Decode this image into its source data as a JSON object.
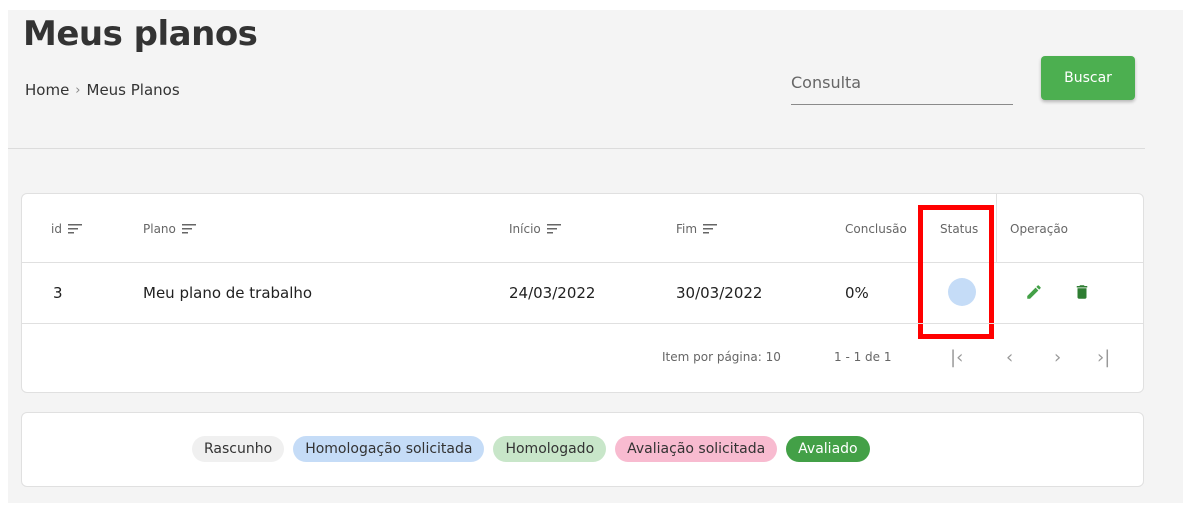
{
  "page": {
    "title": "Meus planos",
    "breadcrumb": [
      "Home",
      "Meus Planos"
    ],
    "search_placeholder": "Consulta",
    "search_button": "Buscar"
  },
  "table": {
    "columns": [
      "id",
      "Plano",
      "Início",
      "Fim",
      "Conclusão",
      "Status",
      "Operação"
    ],
    "rows": [
      {
        "id": "3",
        "plano": "Meu plano de trabalho",
        "inicio": "24/03/2022",
        "fim": "30/03/2022",
        "conclusao": "0%",
        "status_color": "#c5dcf7"
      }
    ],
    "paginator": {
      "items_per_page_label": "Item por página: 10",
      "range": "1 - 1 de 1"
    }
  },
  "legend": [
    {
      "label": "Rascunho",
      "color": "#f0f0f0"
    },
    {
      "label": "Homologação solicitada",
      "color": "#c5dcf7"
    },
    {
      "label": "Homologado",
      "color": "#c8e6c9"
    },
    {
      "label": "Avaliação solicitada",
      "color": "#f8bbd0"
    },
    {
      "label": "Avaliado",
      "color": "#43a047"
    }
  ],
  "colors": {
    "accent": "#4caf50",
    "highlight": "#ff0000",
    "edit_icon": "#43a047",
    "delete_icon": "#2e7d32"
  }
}
